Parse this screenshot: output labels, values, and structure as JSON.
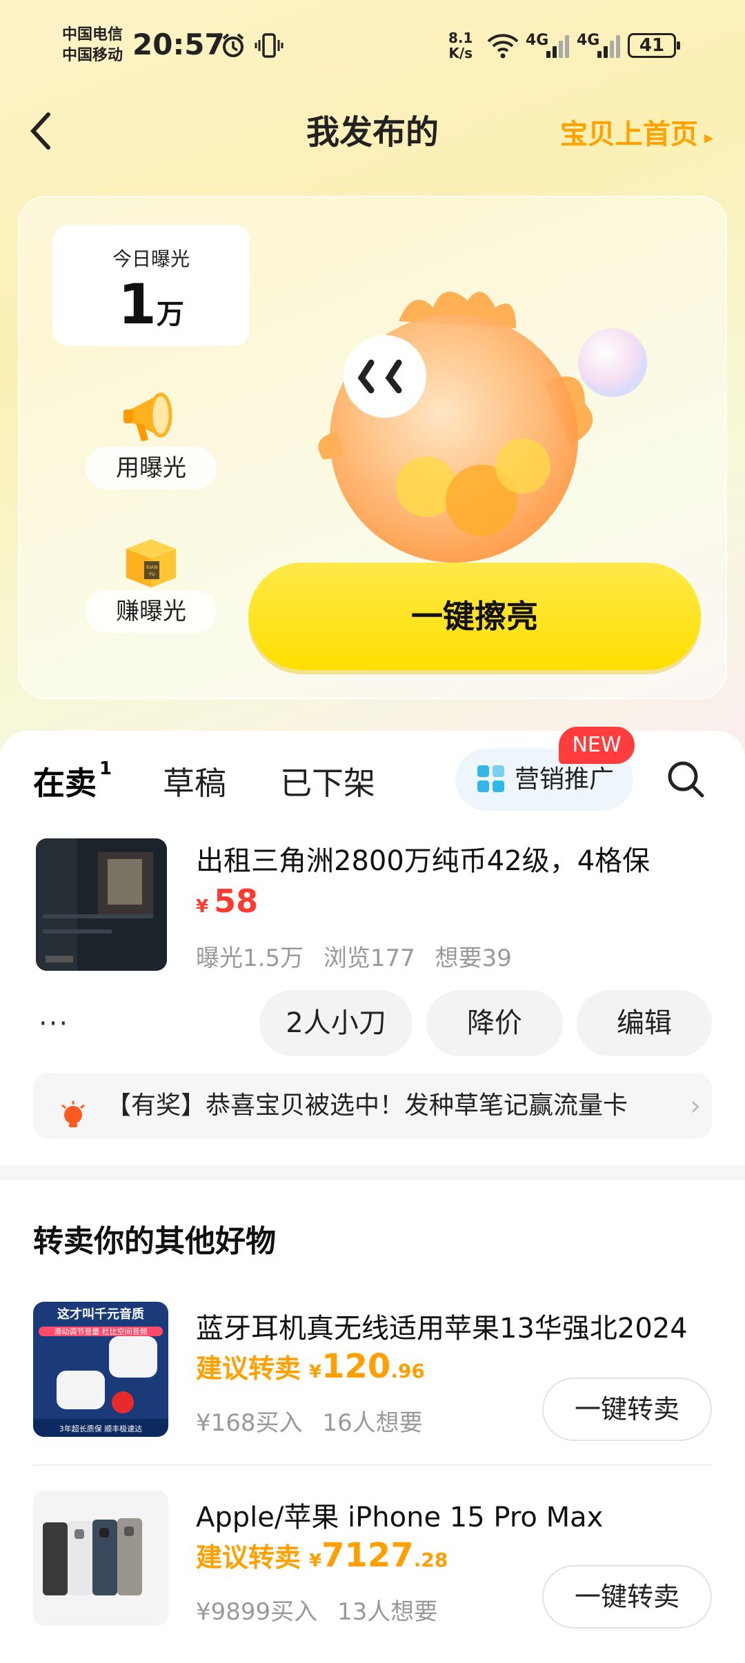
{
  "status_bar": {
    "carrier1": "中国电信",
    "carrier2": "中国移动",
    "time": "20:57",
    "net_speed_value": "8.1",
    "net_speed_unit": "K/s",
    "network1": "4G",
    "network2": "4G",
    "battery": "41"
  },
  "header": {
    "title": "我发布的",
    "home_link": "宝贝上首页"
  },
  "hero": {
    "exposure_label": "今日曝光",
    "exposure_value": "1",
    "exposure_unit": "万",
    "use_exposure": "用曝光",
    "earn_exposure": "赚曝光",
    "box_text_top": "XIAN",
    "box_text_bottom": "YU",
    "shine_button": "一键擦亮"
  },
  "tabs": {
    "on_sale": "在卖",
    "on_sale_count": "1",
    "draft": "草稿",
    "removed": "已下架",
    "marketing": "营销推广",
    "new_badge": "NEW"
  },
  "listing": {
    "title": "出租三角洲2800万纯币42级，4格保",
    "currency": "¥",
    "price": "58",
    "stats": "曝光1.5万 浏览177 想要39",
    "more": "···",
    "bargain_button": "2人小刀",
    "reduce_button": "降价",
    "edit_button": "编辑"
  },
  "notice": {
    "text": "【有奖】恭喜宝贝被选中！发种草笔记赢流量卡"
  },
  "recommend": {
    "section_title": "转卖你的其他好物",
    "items": [
      {
        "title": "蓝牙耳机真无线适用苹果13华强北2024",
        "suggest_label": "建议转卖",
        "currency": "¥",
        "price_int": "120",
        "price_dec": ".96",
        "meta": "¥168买入 16人想要",
        "button": "一键转卖",
        "thumb_text_1": "这才叫千元音质",
        "thumb_text_2": "滑动调节音量 杜比空间音频",
        "thumb_text_3": "3年超长质保 顺丰极速达"
      },
      {
        "title": "Apple/苹果 iPhone 15 Pro Max",
        "suggest_label": "建议转卖",
        "currency": "¥",
        "price_int": "7127",
        "price_dec": ".28",
        "meta": "¥9899买入 13人想要",
        "button": "一键转卖"
      }
    ]
  },
  "colors": {
    "accent_yellow": "#ffe600",
    "price_red": "#ff3a2f",
    "suggest_orange": "#ffa000",
    "new_badge": "#ff3d3d"
  }
}
